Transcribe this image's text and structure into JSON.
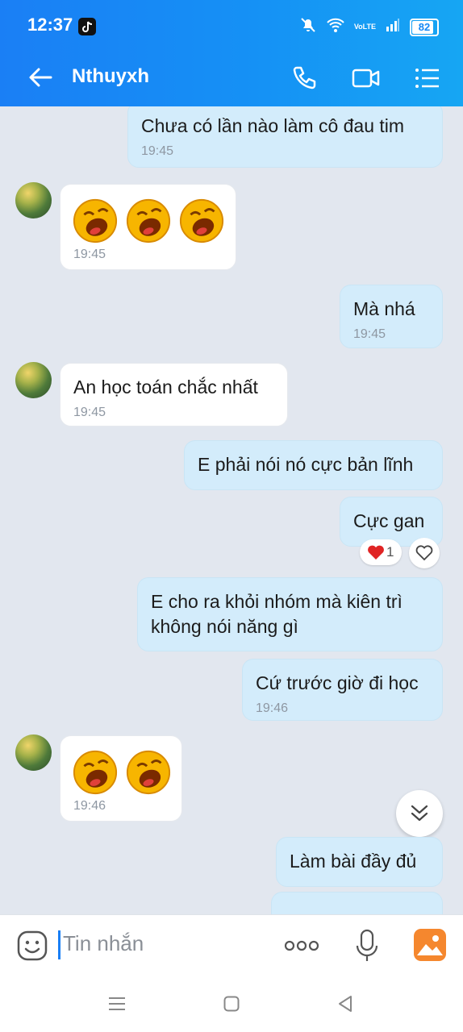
{
  "status_bar": {
    "time": "12:37",
    "battery": "82",
    "network": "VoLTE"
  },
  "header": {
    "contact_name": "Nthuyxh"
  },
  "messages": [
    {
      "dir": "out",
      "text": "Chưa có lần nào làm cô đau tim",
      "time": "19:45"
    },
    {
      "dir": "in",
      "emoji_count": 3,
      "time": "19:45"
    },
    {
      "dir": "out",
      "text": "Mà nhá",
      "time": "19:45"
    },
    {
      "dir": "in",
      "text": "An học toán chắc nhất",
      "time": "19:45"
    },
    {
      "dir": "out",
      "text": "E phải nói nó cực bản lĩnh"
    },
    {
      "dir": "out",
      "text": "Cực gan",
      "reaction": {
        "emoji": "heart",
        "count": "1"
      }
    },
    {
      "dir": "out",
      "lines": [
        "E cho ra khỏi nhóm mà kiên trì",
        "không nói năng gì"
      ]
    },
    {
      "dir": "out",
      "text": "Cứ trước giờ đi học",
      "time": "19:46"
    },
    {
      "dir": "in",
      "emoji_count": 2,
      "time": "19:46"
    },
    {
      "dir": "out",
      "text": "Làm bài đầy đủ"
    }
  ],
  "input": {
    "placeholder": "Tin nhắn"
  },
  "icons": [
    "back-arrow-icon",
    "phone-icon",
    "video-call-icon",
    "menu-icon",
    "sticker-icon",
    "more-icon",
    "voice-icon",
    "image-icon",
    "scroll-down-icon",
    "heart-reaction-icon"
  ],
  "colors": {
    "header": "#1a7ff5",
    "outgoing_bubble": "#d3ecfb",
    "incoming_bubble": "#ffffff",
    "chat_background": "#e2e7ef"
  }
}
